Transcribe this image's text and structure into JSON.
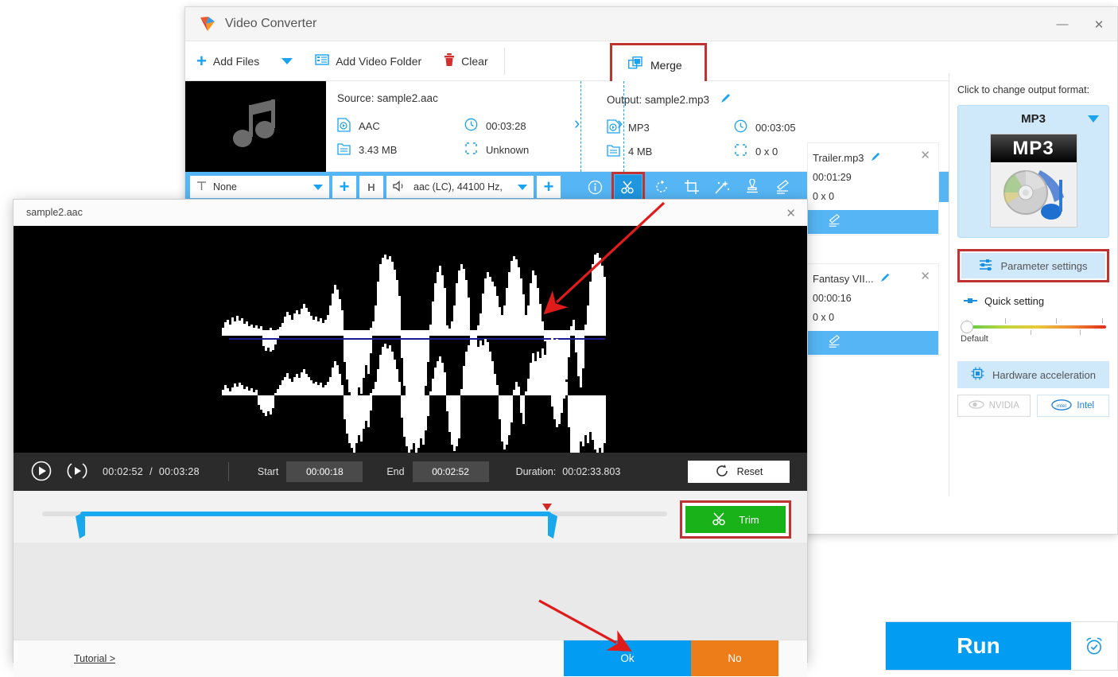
{
  "app": {
    "title": "Video Converter",
    "logo_icon": "app-logo-icon",
    "window_controls": {
      "minimize": "—",
      "close": "✕"
    }
  },
  "toolbar": {
    "add_files": "Add Files",
    "add_files_caret": "dropdown-caret-icon",
    "add_video_folder": "Add Video Folder",
    "clear": "Clear",
    "merge": "Merge"
  },
  "file_row": {
    "thumbnail_icon": "music-note-icon",
    "source_label": "Source: sample2.aac",
    "source": {
      "format": "AAC",
      "duration": "00:03:28",
      "size": "3.43 MB",
      "resolution": "Unknown"
    },
    "output_label": "Output: sample2.mp3",
    "output": {
      "format": "MP3",
      "duration": "00:03:05",
      "size": "4 MB",
      "resolution": "0 x 0"
    },
    "close_icon": "✕",
    "edit_icon": "pencil-icon"
  },
  "action_bar": {
    "subtitle_value": "None",
    "subtitle_icon": "subtitle-T-icon",
    "add_subtitle": "+",
    "hdr_button": "H",
    "audio_track": "aac (LC), 44100 Hz,",
    "audio_icon": "speaker-icon",
    "add_audio": "+",
    "tools": [
      {
        "name": "info-icon",
        "glyph": "ⓘ"
      },
      {
        "name": "trim-scissors-icon",
        "glyph": "scissors"
      },
      {
        "name": "rotate-icon",
        "glyph": "rotate"
      },
      {
        "name": "crop-icon",
        "glyph": "crop"
      },
      {
        "name": "effect-magic-icon",
        "glyph": "magic"
      },
      {
        "name": "watermark-icon",
        "glyph": "stamp"
      },
      {
        "name": "edit-pencil-icon",
        "glyph": "edit"
      }
    ]
  },
  "queue_items": [
    {
      "title": "Trailer.mp3",
      "duration": "00:01:29",
      "resolution": "0 x 0"
    },
    {
      "title": "Fantasy VII...",
      "duration": "00:00:16",
      "resolution": "0 x 0"
    }
  ],
  "right_panel": {
    "heading": "Click to change output format:",
    "format_name": "MP3",
    "format_badge": "MP3",
    "parameter_settings": "Parameter settings",
    "quick_setting": "Quick setting",
    "slider_label": "Default",
    "hardware_acceleration": "Hardware acceleration",
    "gpu_nvidia": "NVIDIA",
    "gpu_intel": "Intel"
  },
  "run_bar": {
    "run_label": "Run",
    "alarm_icon": "alarm-clock-icon"
  },
  "trim_dialog": {
    "title": "sample2.aac",
    "close_icon": "✕",
    "play_icon": "play-button-icon",
    "preview_icon": "preview-segment-icon",
    "current_time": "00:02:52",
    "time_separator": "/",
    "total_time": "00:03:28",
    "start_label": "Start",
    "start_value": "00:00:18",
    "end_label": "End",
    "end_value": "00:02:52",
    "duration_label": "Duration:",
    "duration_value": "00:02:33.803",
    "reset_label": "Reset",
    "reset_icon": "refresh-icon",
    "trim_label": "Trim",
    "trim_icon": "scissors-icon",
    "tutorial_link": "Tutorial >",
    "ok_label": "Ok",
    "no_label": "No",
    "range_start_pct": 8,
    "range_end_pct": 83
  },
  "colors": {
    "accent_blue": "#029df2",
    "light_blue_bar": "#56b6f5",
    "highlight_red": "#bf3333",
    "trim_green": "#19b319",
    "no_orange": "#ed7d18",
    "panel_blue": "#cfe8fa"
  }
}
